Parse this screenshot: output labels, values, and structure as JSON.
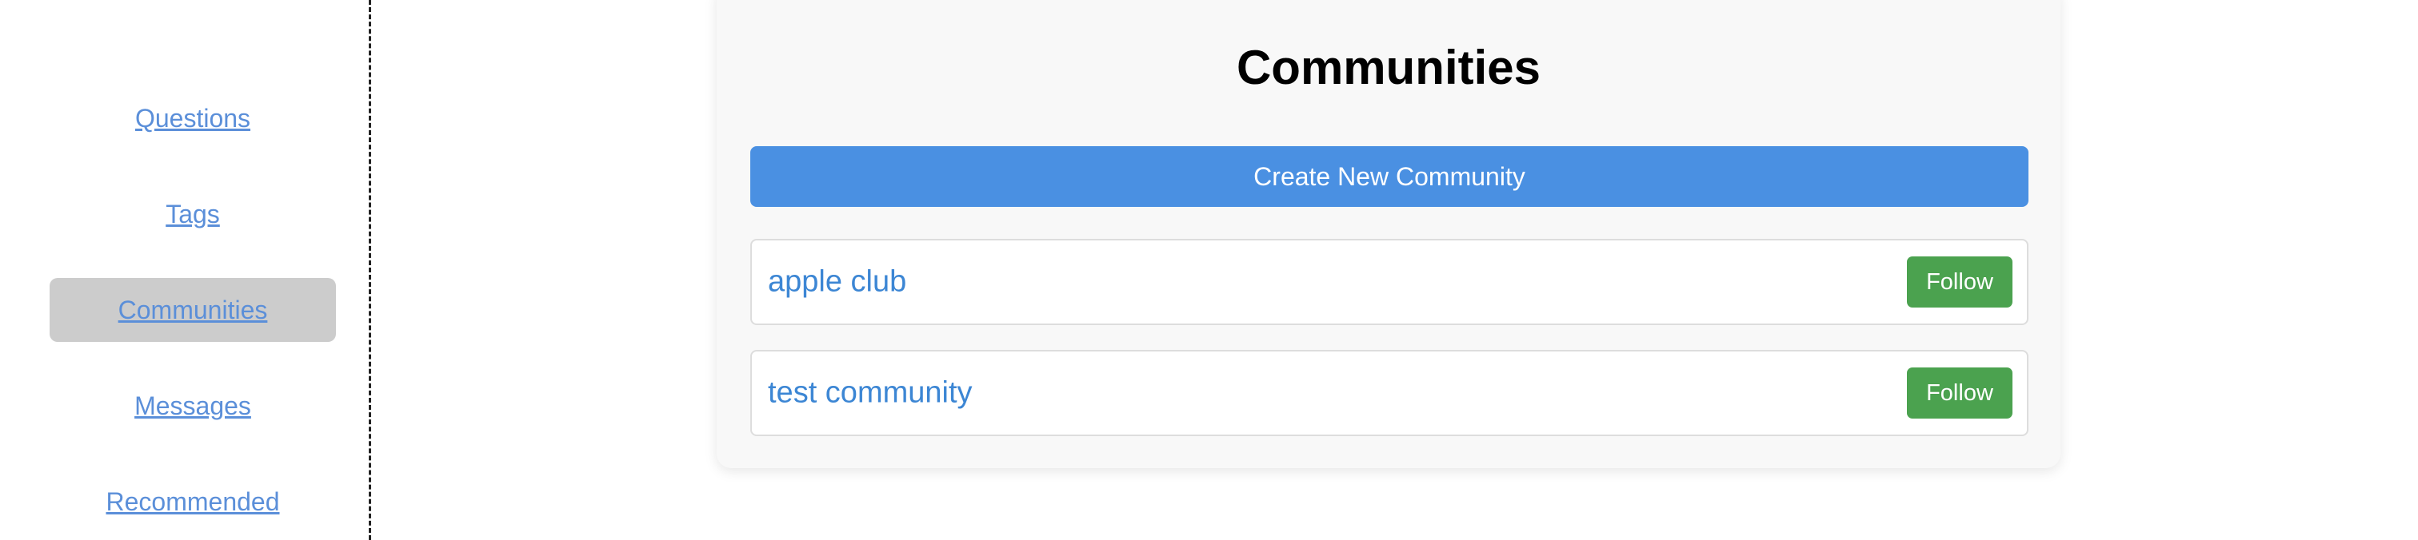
{
  "sidebar": {
    "items": [
      {
        "label": "Questions",
        "active": false
      },
      {
        "label": "Tags",
        "active": false
      },
      {
        "label": "Communities",
        "active": true
      },
      {
        "label": "Messages",
        "active": false
      },
      {
        "label": "Recommended",
        "active": false
      }
    ]
  },
  "main": {
    "title": "Communities",
    "create_button_label": "Create New Community",
    "communities": [
      {
        "name": "apple club",
        "follow_label": "Follow"
      },
      {
        "name": "test community",
        "follow_label": "Follow"
      }
    ]
  },
  "colors": {
    "link": "#5b8fd9",
    "active_nav_bg": "#cccccc",
    "primary_button": "#4a90e2",
    "follow_button": "#4ba24f",
    "community_name": "#3c86d4"
  }
}
